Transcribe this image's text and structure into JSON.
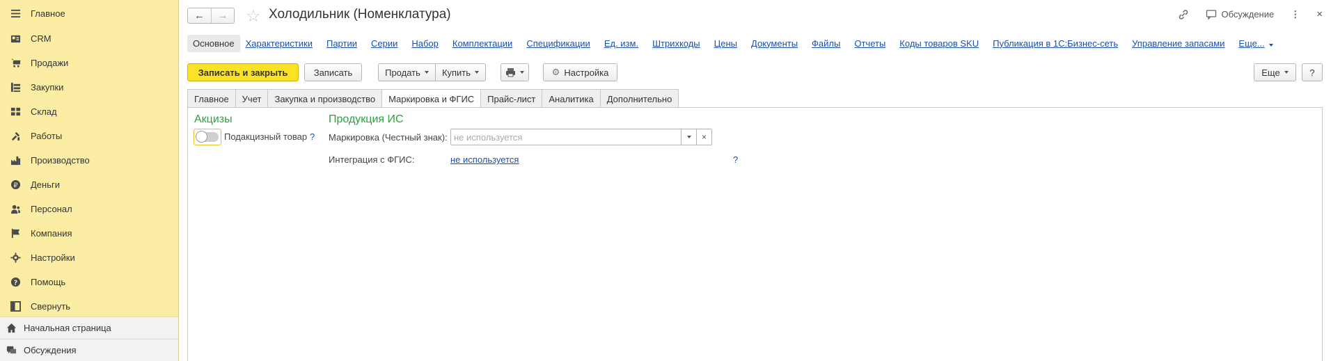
{
  "sidebar": {
    "items": [
      {
        "label": "Главное",
        "icon": "menu-icon"
      },
      {
        "label": "CRM",
        "icon": "crm-icon"
      },
      {
        "label": "Продажи",
        "icon": "cart-icon"
      },
      {
        "label": "Закупки",
        "icon": "purchases-icon"
      },
      {
        "label": "Склад",
        "icon": "warehouse-icon"
      },
      {
        "label": "Работы",
        "icon": "tools-icon"
      },
      {
        "label": "Производство",
        "icon": "factory-icon"
      },
      {
        "label": "Деньги",
        "icon": "ruble-icon"
      },
      {
        "label": "Персонал",
        "icon": "people-icon"
      },
      {
        "label": "Компания",
        "icon": "flag-icon"
      },
      {
        "label": "Настройки",
        "icon": "gear-icon"
      },
      {
        "label": "Помощь",
        "icon": "help-icon"
      },
      {
        "label": "Свернуть",
        "icon": "collapse-icon"
      }
    ],
    "bottom": [
      {
        "label": "Начальная страница",
        "icon": "home-icon"
      },
      {
        "label": "Обсуждения",
        "icon": "discussions-icon"
      }
    ]
  },
  "header": {
    "title": "Холодильник (Номенклатура)",
    "back": "←",
    "forward": "→",
    "discussion_label": "Обсуждение",
    "more_symbol": "⋮",
    "close_symbol": "×"
  },
  "links": {
    "current": "Основное",
    "items": [
      "Характеристики",
      "Партии",
      "Серии",
      "Набор",
      "Комплектации",
      "Спецификации",
      "Ед. изм.",
      "Штрихкоды",
      "Цены",
      "Документы",
      "Файлы",
      "Отчеты",
      "Коды товаров SKU",
      "Публикация в 1С:Бизнес-сеть",
      "Управление запасами"
    ],
    "more": "Еще..."
  },
  "toolbar": {
    "save_close": "Записать и закрыть",
    "save": "Записать",
    "sell": "Продать",
    "buy": "Купить",
    "settings": "Настройка",
    "more": "Еще",
    "help": "?"
  },
  "tabs": [
    "Главное",
    "Учет",
    "Закупка и производство",
    "Маркировка и ФГИС",
    "Прайс-лист",
    "Аналитика",
    "Дополнительно"
  ],
  "active_tab": "Маркировка и ФГИС",
  "excise": {
    "title": "Акцизы",
    "toggle_label": "Подакцизный товар",
    "toggle_on": false,
    "help": "?"
  },
  "products": {
    "title": "Продукция ИС",
    "marking_label": "Маркировка (Честный знак):",
    "marking_placeholder": "не используется",
    "marking_value": "",
    "fgis_label": "Интеграция с ФГИС:",
    "fgis_value": "не используется",
    "help": "?"
  },
  "colors": {
    "sidebar_bg": "#fbeea4",
    "primary_button": "#fce224",
    "group_title": "#2da23c",
    "link": "#1c4fa8"
  }
}
